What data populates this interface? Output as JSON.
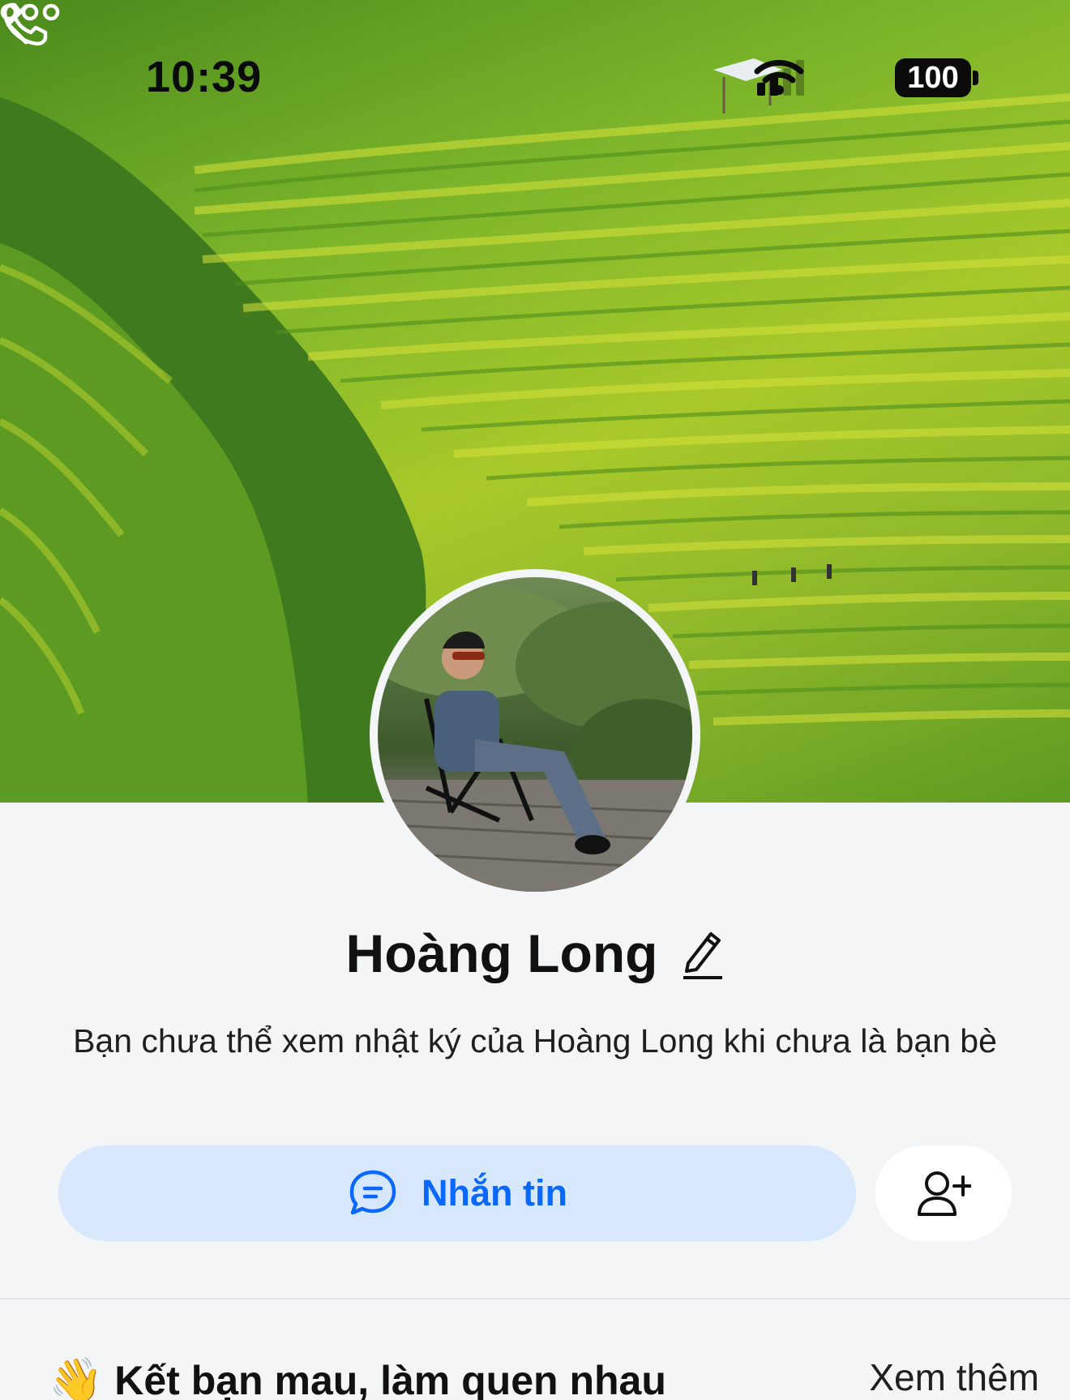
{
  "status_bar": {
    "time": "10:39",
    "battery": "100",
    "icons": [
      "signal-icon",
      "wifi-icon",
      "battery-icon"
    ]
  },
  "nav": {
    "icons": [
      "chevron-left-icon",
      "phone-icon",
      "more-horizontal-icon"
    ]
  },
  "profile": {
    "name": "Hoàng Long",
    "notice": "Bạn chưa thể xem nhật ký của Hoàng Long khi chưa là bạn bè"
  },
  "actions": {
    "message_label": "Nhắn tin",
    "message_icon": "chat-bubble-icon",
    "add_friend_icon": "add-user-icon"
  },
  "suggestions": {
    "emoji": "👋",
    "title": "Kết bạn mau, làm quen nhau",
    "see_more": "Xem thêm"
  },
  "colors": {
    "accent": "#0a68ff",
    "message_button_bg": "#d8e8fc",
    "page_bg": "#f4f5f7"
  }
}
